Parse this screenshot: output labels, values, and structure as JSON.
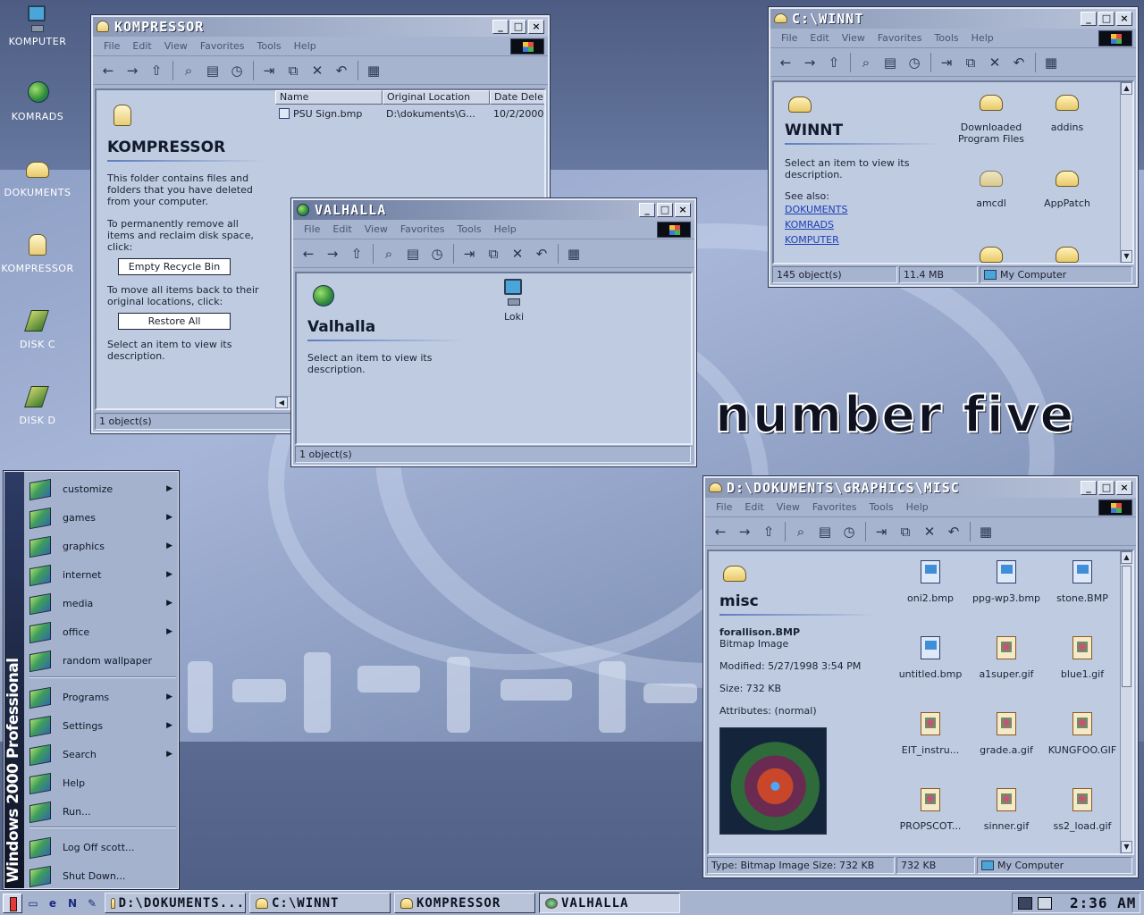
{
  "desktop": {
    "icons": [
      {
        "label": "KOMPUTER",
        "icon": "computer-icon"
      },
      {
        "label": "KOMRADS",
        "icon": "network-icon"
      },
      {
        "label": "DOKUMENTS",
        "icon": "documents-icon"
      },
      {
        "label": "KOMPRESSOR",
        "icon": "recycle-bin-icon"
      },
      {
        "label": "DISK C",
        "icon": "drive-icon"
      },
      {
        "label": "DISK D",
        "icon": "drive-icon"
      }
    ],
    "wallpaper_text": "number five"
  },
  "menu": [
    "File",
    "Edit",
    "View",
    "Favorites",
    "Tools",
    "Help"
  ],
  "kompressor": {
    "title": "KOMPRESSOR",
    "pane_title": "KOMPRESSOR",
    "desc": "This folder contains files and folders that you have deleted from your computer.",
    "remove_text": "To permanently remove all items and reclaim disk space, click:",
    "empty_button": "Empty Recycle Bin",
    "restore_text": "To move all items back to their original locations, click:",
    "restore_button": "Restore All",
    "select_text": "Select an item to view its description.",
    "columns": [
      "Name",
      "Original Location",
      "Date Dele"
    ],
    "rows": [
      {
        "name": "PSU Sign.bmp",
        "location": "D:\\dokuments\\G...",
        "date": "10/2/2000"
      }
    ],
    "status": "1 object(s)"
  },
  "valhalla": {
    "title": "VALHALLA",
    "pane_title": "Valhalla",
    "select_text": "Select an item to view its description.",
    "items": [
      {
        "label": "Loki"
      }
    ],
    "status": "1 object(s)"
  },
  "winnt": {
    "title": "C:\\WINNT",
    "pane_title": "WINNT",
    "select_text": "Select an item to view its description.",
    "see_also_label": "See also:",
    "links": [
      "DOKUMENTS",
      "KOMRADS",
      "KOMPUTER"
    ],
    "items": [
      {
        "label": "Downloaded Program Files"
      },
      {
        "label": "addins"
      },
      {
        "label": "amcdl"
      },
      {
        "label": "AppPatch"
      }
    ],
    "status": {
      "objects": "145 object(s)",
      "size": "11.4 MB",
      "zone": "My Computer"
    }
  },
  "misc": {
    "title": "D:\\DOKUMENTS\\GRAPHICS\\MISC",
    "pane_title": "misc",
    "selected_name": "forallison.BMP",
    "selected_type": "Bitmap Image",
    "modified": "Modified: 5/27/1998 3:54 PM",
    "size": "Size: 732 KB",
    "attributes": "Attributes: (normal)",
    "files": [
      {
        "name": "oni2.bmp",
        "kind": "bmp"
      },
      {
        "name": "ppg-wp3.bmp",
        "kind": "bmp"
      },
      {
        "name": "stone.BMP",
        "kind": "bmp"
      },
      {
        "name": "untitled.bmp",
        "kind": "bmp"
      },
      {
        "name": "a1super.gif",
        "kind": "gif"
      },
      {
        "name": "blue1.gif",
        "kind": "gif"
      },
      {
        "name": "EIT_instru...",
        "kind": "gif"
      },
      {
        "name": "grade.a.gif",
        "kind": "gif"
      },
      {
        "name": "KUNGFOO.GIF",
        "kind": "gif"
      },
      {
        "name": "PROPSCOT...",
        "kind": "gif"
      },
      {
        "name": "sinner.gif",
        "kind": "gif"
      },
      {
        "name": "ss2_load.gif",
        "kind": "gif"
      }
    ],
    "status": {
      "type": "Type: Bitmap Image Size: 732 KB",
      "size": "732 KB",
      "zone": "My Computer"
    }
  },
  "start_menu": {
    "band_text": "Windows 2000 Professional",
    "items": [
      {
        "label": "customize",
        "arrow": true
      },
      {
        "label": "games",
        "arrow": true
      },
      {
        "label": "graphics",
        "arrow": true
      },
      {
        "label": "internet",
        "arrow": true
      },
      {
        "label": "media",
        "arrow": true
      },
      {
        "label": "office",
        "arrow": true
      },
      {
        "label": "random wallpaper",
        "arrow": false
      },
      {
        "label": "Programs",
        "arrow": true
      },
      {
        "label": "Settings",
        "arrow": true
      },
      {
        "label": "Search",
        "arrow": true
      },
      {
        "label": "Help",
        "arrow": false
      },
      {
        "label": "Run...",
        "arrow": false
      },
      {
        "label": "Log Off scott...",
        "arrow": false
      },
      {
        "label": "Shut Down...",
        "arrow": false
      }
    ]
  },
  "taskbar": {
    "tasks": [
      {
        "label": "D:\\DOKUMENTS..."
      },
      {
        "label": "C:\\WINNT"
      },
      {
        "label": "KOMPRESSOR"
      },
      {
        "label": "VALHALLA"
      }
    ],
    "clock": "2:36 AM"
  },
  "colors": {
    "accent": "#5d7cc0",
    "window": "#a7b4cf",
    "pane": "#bfcbe0",
    "link": "#1d3fb8"
  }
}
